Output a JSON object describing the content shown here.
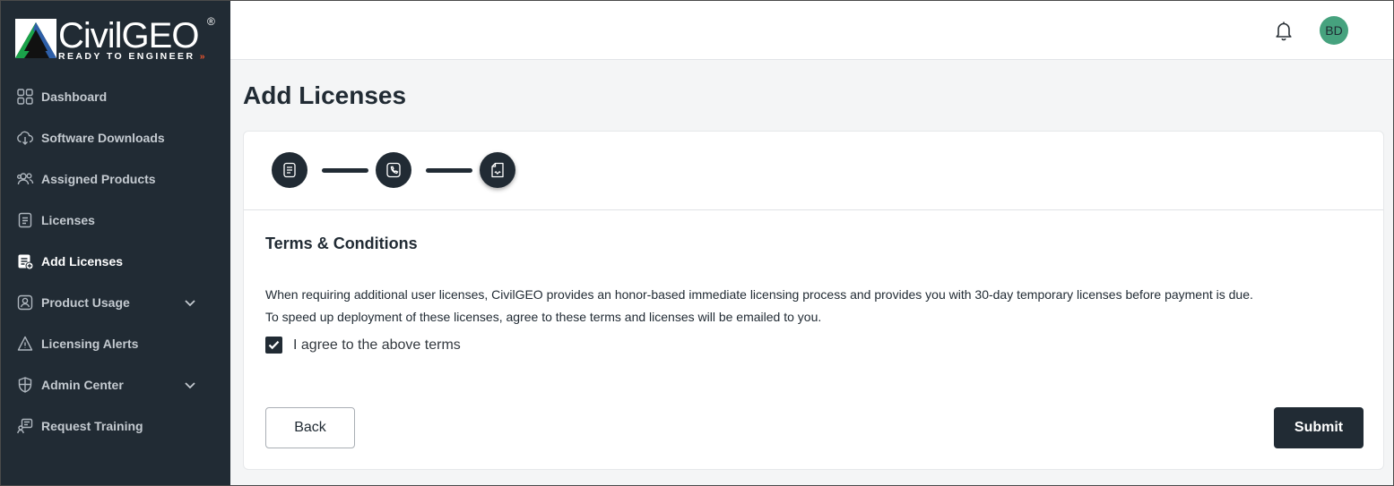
{
  "brand": {
    "name": "CivilGEO",
    "registered": "®",
    "tagline": "READY TO ENGINEER",
    "tagline_arrows": "»",
    "accent": "#e8542d"
  },
  "sidebar": {
    "items": [
      {
        "label": "Dashboard",
        "icon": "grid-icon",
        "active": false
      },
      {
        "label": "Software Downloads",
        "icon": "cloud-download-icon",
        "active": false
      },
      {
        "label": "Assigned Products",
        "icon": "users-icon",
        "active": false
      },
      {
        "label": "Licenses",
        "icon": "document-icon",
        "active": false
      },
      {
        "label": "Add Licenses",
        "icon": "add-document-icon",
        "active": true
      },
      {
        "label": "Product Usage",
        "icon": "usage-icon",
        "active": false,
        "expandable": true
      },
      {
        "label": "Licensing Alerts",
        "icon": "alert-icon",
        "active": false
      },
      {
        "label": "Admin Center",
        "icon": "shield-icon",
        "active": false,
        "expandable": true
      },
      {
        "label": "Request Training",
        "icon": "training-icon",
        "active": false
      }
    ]
  },
  "header": {
    "notifications_icon": "bell-icon",
    "avatar_initials": "BD",
    "avatar_color": "#46a27e"
  },
  "page": {
    "title": "Add Licenses"
  },
  "stepper": {
    "steps": [
      {
        "icon": "document-icon",
        "state": "complete"
      },
      {
        "icon": "phone-icon",
        "state": "complete"
      },
      {
        "icon": "contract-icon",
        "state": "current"
      }
    ]
  },
  "terms": {
    "title": "Terms & Conditions",
    "line1": "When requiring additional user licenses, CivilGEO provides an honor-based immediate licensing process and provides you with 30-day temporary licenses before payment is due.",
    "line2": "To speed up deployment of these licenses, agree to these terms and licenses will be emailed to you.",
    "agree_label": "I agree to the above terms",
    "agree_checked": true
  },
  "actions": {
    "back_label": "Back",
    "submit_label": "Submit"
  },
  "colors": {
    "sidebar_bg": "#212b34",
    "primary": "#212b34",
    "page_bg": "#f4f5f6"
  }
}
